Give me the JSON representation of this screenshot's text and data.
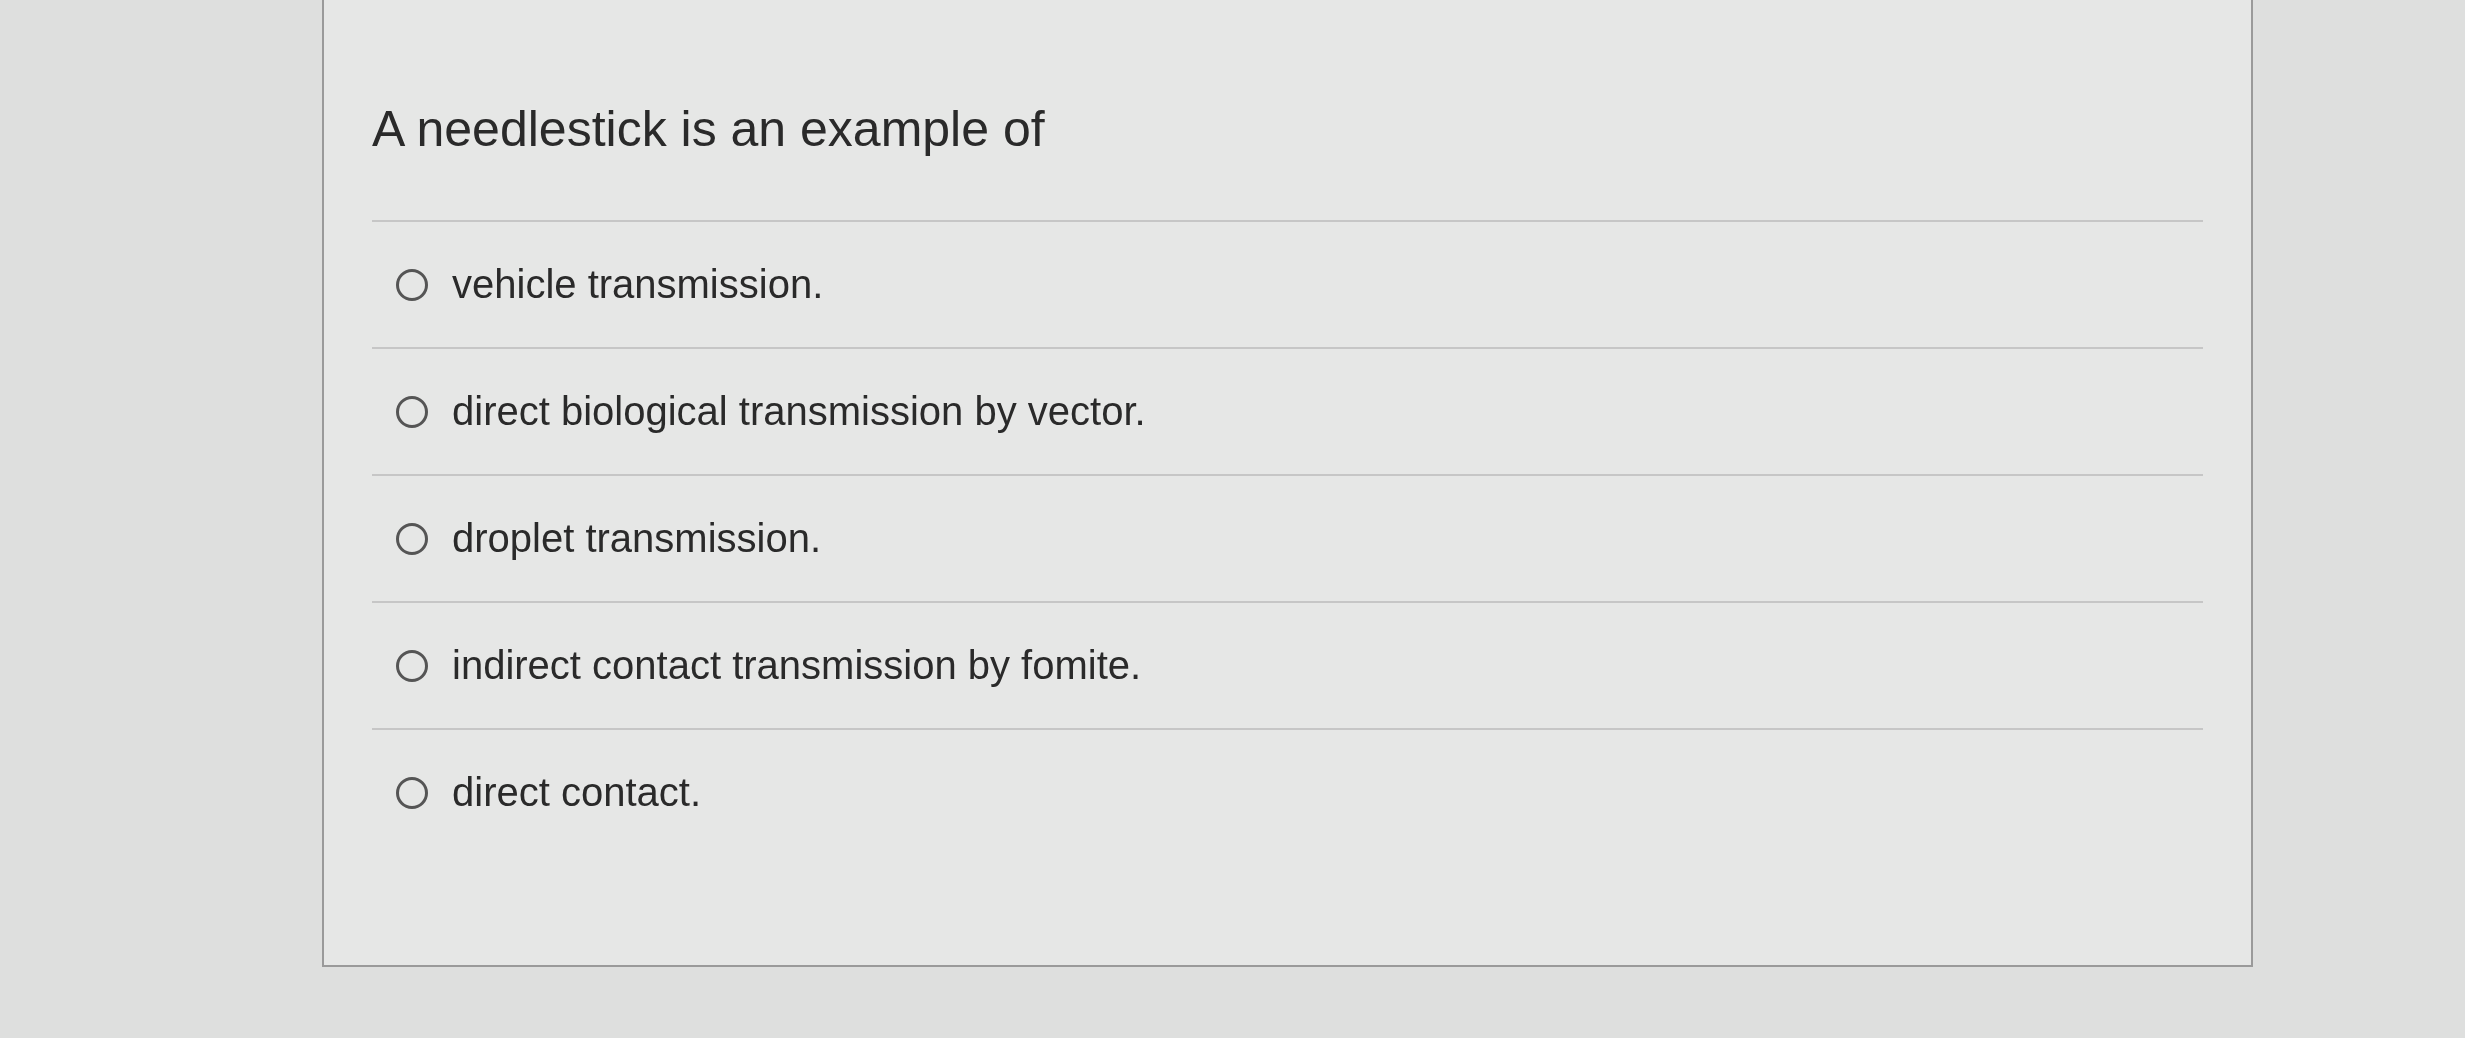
{
  "question": {
    "text": "A needlestick is an example of"
  },
  "options": [
    {
      "label": "vehicle transmission.",
      "selected": false
    },
    {
      "label": "direct biological transmission by vector.",
      "selected": false
    },
    {
      "label": "droplet transmission.",
      "selected": false
    },
    {
      "label": "indirect contact transmission by fomite.",
      "selected": false
    },
    {
      "label": "direct contact.",
      "selected": false
    }
  ]
}
